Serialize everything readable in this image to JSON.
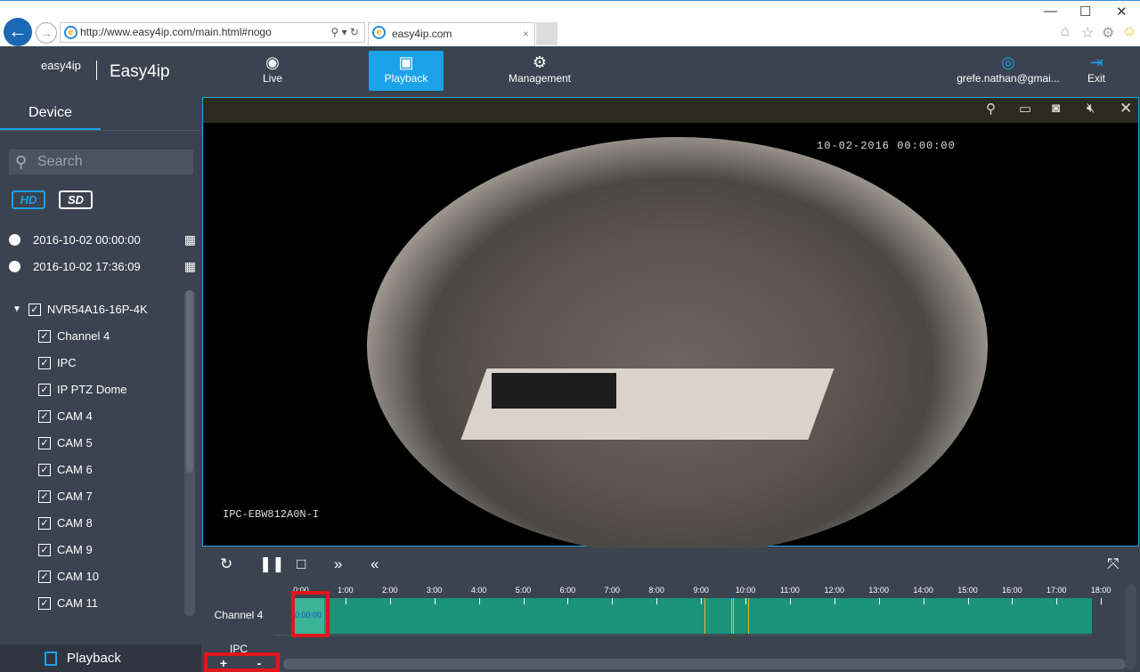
{
  "browser": {
    "url": "http://www.easy4ip.com/main.html#nogo",
    "tab_title": "easy4ip.com"
  },
  "header": {
    "logo_text": "easy4ip",
    "brand": "Easy4ip",
    "nav": [
      {
        "label": "Live",
        "icon": "eye-icon"
      },
      {
        "label": "Playback",
        "icon": "film-icon",
        "active": true
      },
      {
        "label": "Management",
        "icon": "gear-icon"
      }
    ],
    "user": "grefe.nathan@gmai...",
    "exit": "Exit"
  },
  "sidebar": {
    "tab": "Device",
    "search_placeholder": "Search",
    "quality": [
      "HD",
      "SD"
    ],
    "start_time": "2016-10-02 00:00:00",
    "end_time": "2016-10-02 17:36:09",
    "device": "NVR54A16-16P-4K",
    "channels": [
      "Channel 4",
      "IPC",
      "IP PTZ Dome",
      "CAM 4",
      "CAM 5",
      "CAM 6",
      "CAM 7",
      "CAM 8",
      "CAM 9",
      "CAM 10",
      "CAM 11"
    ],
    "footer": "Playback"
  },
  "video": {
    "osd_time": "10-02-2016 00:00:00",
    "osd_name": "IPC-EBW812A0N-I"
  },
  "timeline": {
    "ticks": [
      "0:00",
      "1:00",
      "2:00",
      "3:00",
      "4:00",
      "5:00",
      "6:00",
      "7:00",
      "8:00",
      "9:00",
      "10:00",
      "11:00",
      "12:00",
      "13:00",
      "14:00",
      "15:00",
      "16:00",
      "17:00",
      "18:00"
    ],
    "rows": [
      "Channel 4",
      "IPC"
    ],
    "cursor_time": "0:00:00",
    "recording_hours": [
      0,
      17.8
    ],
    "event_marks_hours": [
      9.08,
      9.68,
      9.72,
      10.06
    ],
    "zoom_in": "+",
    "zoom_out": "-"
  },
  "colors": {
    "accent": "#1aa3e8",
    "recording": "#1b9479",
    "event": "#e7b827",
    "highlight": "#e0161c"
  }
}
